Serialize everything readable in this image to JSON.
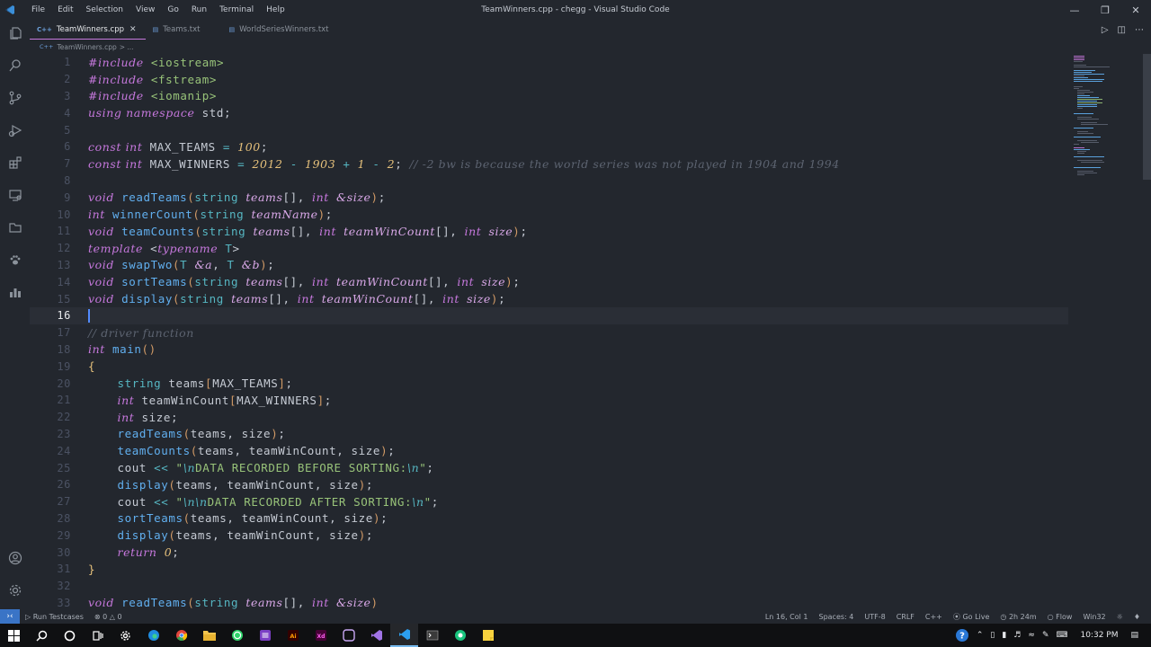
{
  "titlebar": {
    "menu": [
      "File",
      "Edit",
      "Selection",
      "View",
      "Go",
      "Run",
      "Terminal",
      "Help"
    ],
    "title": "TeamWinners.cpp - chegg - Visual Studio Code"
  },
  "tabs": [
    {
      "label": "TeamWinners.cpp",
      "icon": "C++",
      "active": true
    },
    {
      "label": "Teams.txt",
      "icon": "txt",
      "active": false
    },
    {
      "label": "WorldSeriesWinners.txt",
      "icon": "txt",
      "active": false
    }
  ],
  "breadcrumb": {
    "file": "TeamWinners.cpp",
    "rest": "> ..."
  },
  "editor": {
    "current_line": 16,
    "line_numbers": [
      "1",
      "2",
      "3",
      "4",
      "5",
      "6",
      "7",
      "8",
      "9",
      "10",
      "11",
      "12",
      "13",
      "14",
      "15",
      "16",
      "17",
      "18",
      "19",
      "20",
      "21",
      "22",
      "23",
      "24",
      "25",
      "26",
      "27",
      "28",
      "29",
      "30",
      "31",
      "32",
      "33"
    ]
  },
  "status": {
    "run_testcases": "Run Testcases",
    "errors": "0",
    "warnings": "0",
    "position": "Ln 16, Col 1",
    "spaces": "Spaces: 4",
    "encoding": "UTF-8",
    "eol": "CRLF",
    "language": "C++",
    "go_live": "Go Live",
    "time_tracked": "2h 24m",
    "flow": "Flow",
    "platform": "Win32"
  },
  "taskbar": {
    "clock": "10:32 PM",
    "app_icons": [
      "search-icon",
      "cortana-icon",
      "task-view-icon",
      "settings-icon",
      "edge-icon",
      "chrome-icon",
      "file-explorer-icon",
      "whatsapp-icon",
      "app-purple-icon",
      "illustrator-icon",
      "xd-icon",
      "obs-icon",
      "visual-studio-icon",
      "vscode-icon",
      "terminal-icon",
      "app-green-icon",
      "sticky-notes-icon"
    ]
  },
  "colors": {
    "accent": "#528bff",
    "keyword": "#c678dd",
    "function": "#61afef",
    "string": "#98c379",
    "number": "#e5c07b"
  }
}
